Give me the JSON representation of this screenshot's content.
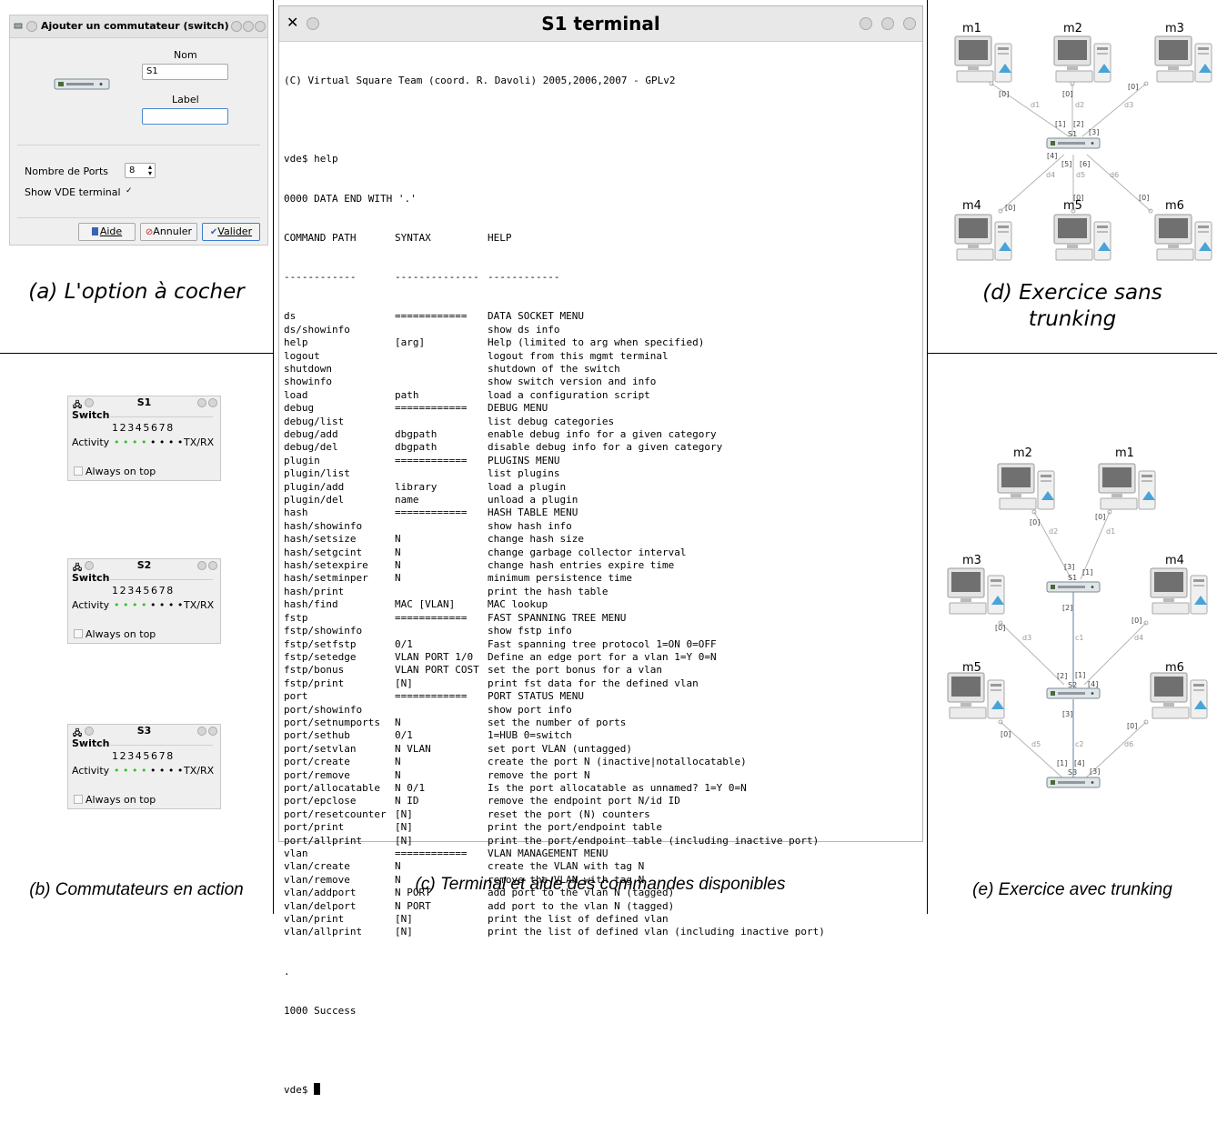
{
  "captions": {
    "a": "(a) L'option à cocher",
    "b": "(b) Commutateurs en action",
    "c": "(c) Terminal et aide des commandes disponibles",
    "d": "(d) Exercice sans trunking",
    "e": "(e) Exercice avec trunking"
  },
  "dialog": {
    "title": "Ajouter un commutateur (switch)",
    "nom_label": "Nom",
    "nom_value": "S1",
    "label_label": "Label",
    "label_value": "",
    "ports_label": "Nombre de Ports",
    "ports_value": "8",
    "show_terminal_label": "Show VDE terminal",
    "show_terminal_checked": "✓",
    "btn_aide": "Aide",
    "btn_annuler": "Annuler",
    "btn_valider": "Valider"
  },
  "switches": [
    {
      "title": "S1",
      "group": "Switch",
      "ports": "12345678",
      "activity_label": "Activity",
      "dots": "• • • • • • • •",
      "txrx": "TX/RX",
      "always_on_top": "Always on top"
    },
    {
      "title": "S2",
      "group": "Switch",
      "ports": "12345678",
      "activity_label": "Activity",
      "dots": "• • • • • • • •",
      "txrx": "TX/RX",
      "always_on_top": "Always on top"
    },
    {
      "title": "S3",
      "group": "Switch",
      "ports": "12345678",
      "activity_label": "Activity",
      "dots": "• • • • • • • •",
      "txrx": "TX/RX",
      "always_on_top": "Always on top"
    }
  ],
  "terminal": {
    "title": "S1 terminal",
    "header": "(C) Virtual Square Team (coord. R. Davoli) 2005,2006,2007 - GPLv2",
    "prompt_cmd": "vde$ help",
    "data_end": "0000 DATA END WITH '.'",
    "col_headers": [
      "COMMAND PATH",
      "SYNTAX",
      "HELP"
    ],
    "col_rules": [
      "------------",
      "--------------",
      "------------"
    ],
    "rows": [
      [
        "ds",
        "============",
        "DATA SOCKET MENU"
      ],
      [
        "ds/showinfo",
        "",
        "show ds info"
      ],
      [
        "help",
        "[arg]",
        "Help (limited to arg when specified)"
      ],
      [
        "logout",
        "",
        "logout from this mgmt terminal"
      ],
      [
        "shutdown",
        "",
        "shutdown of the switch"
      ],
      [
        "showinfo",
        "",
        "show switch version and info"
      ],
      [
        "load",
        "path",
        "load a configuration script"
      ],
      [
        "debug",
        "============",
        "DEBUG MENU"
      ],
      [
        "debug/list",
        "",
        "list debug categories"
      ],
      [
        "debug/add",
        "dbgpath",
        "enable debug info for a given category"
      ],
      [
        "debug/del",
        "dbgpath",
        "disable debug info for a given category"
      ],
      [
        "plugin",
        "============",
        "PLUGINS MENU"
      ],
      [
        "plugin/list",
        "",
        "list plugins"
      ],
      [
        "plugin/add",
        "library",
        "load a plugin"
      ],
      [
        "plugin/del",
        "name",
        "unload a plugin"
      ],
      [
        "hash",
        "============",
        "HASH TABLE MENU"
      ],
      [
        "hash/showinfo",
        "",
        "show hash info"
      ],
      [
        "hash/setsize",
        "N",
        "change hash size"
      ],
      [
        "hash/setgcint",
        "N",
        "change garbage collector interval"
      ],
      [
        "hash/setexpire",
        "N",
        "change hash entries expire time"
      ],
      [
        "hash/setminper",
        "N",
        "minimum persistence time"
      ],
      [
        "hash/print",
        "",
        "print the hash table"
      ],
      [
        "hash/find",
        "MAC [VLAN]",
        "MAC lookup"
      ],
      [
        "fstp",
        "============",
        "FAST SPANNING TREE MENU"
      ],
      [
        "fstp/showinfo",
        "",
        "show fstp info"
      ],
      [
        "fstp/setfstp",
        "0/1",
        "Fast spanning tree protocol 1=ON 0=OFF"
      ],
      [
        "fstp/setedge",
        "VLAN PORT 1/0",
        "Define an edge port for a vlan 1=Y 0=N"
      ],
      [
        "fstp/bonus",
        "VLAN PORT COST",
        "set the port bonus for a vlan"
      ],
      [
        "fstp/print",
        "[N]",
        "print fst data for the defined vlan"
      ],
      [
        "port",
        "============",
        "PORT STATUS MENU"
      ],
      [
        "port/showinfo",
        "",
        "show port info"
      ],
      [
        "port/setnumports",
        "N",
        "set the number of ports"
      ],
      [
        "port/sethub",
        "0/1",
        "1=HUB 0=switch"
      ],
      [
        "port/setvlan",
        "N VLAN",
        "set port VLAN (untagged)"
      ],
      [
        "port/create",
        "N",
        "create the port N (inactive|notallocatable)"
      ],
      [
        "port/remove",
        "N",
        "remove the port N"
      ],
      [
        "port/allocatable",
        "N 0/1",
        "Is the port allocatable as unnamed? 1=Y 0=N"
      ],
      [
        "port/epclose",
        "N ID",
        "remove the endpoint port N/id ID"
      ],
      [
        "port/resetcounter",
        "[N]",
        "reset the port (N) counters"
      ],
      [
        "port/print",
        "[N]",
        "print the port/endpoint table"
      ],
      [
        "port/allprint",
        "[N]",
        "print the port/endpoint table (including inactive port)"
      ],
      [
        "vlan",
        "============",
        "VLAN MANAGEMENT MENU"
      ],
      [
        "vlan/create",
        "N",
        "create the VLAN with tag N"
      ],
      [
        "vlan/remove",
        "N",
        "remove the VLAN with tag N"
      ],
      [
        "vlan/addport",
        "N PORT",
        "add port to the vlan N (tagged)"
      ],
      [
        "vlan/delport",
        "N PORT",
        "add port to the vlan N (tagged)"
      ],
      [
        "vlan/print",
        "[N]",
        "print the list of defined vlan"
      ],
      [
        "vlan/allprint",
        "[N]",
        "print the list of defined vlan (including inactive port)"
      ]
    ],
    "dot": ".",
    "success": "1000 Success",
    "prompt": "vde$"
  },
  "diagram_d": {
    "machines": [
      "m1",
      "m2",
      "m3",
      "m4",
      "m5",
      "m6"
    ],
    "switch": "S1",
    "links": [
      "d1",
      "d2",
      "d3",
      "d4",
      "d5",
      "d6"
    ],
    "ports": [
      "[0]",
      "[1]",
      "[2]",
      "[3]",
      "[4]",
      "[5]",
      "[6]"
    ]
  },
  "diagram_e": {
    "machines": [
      "m2",
      "m1",
      "m3",
      "m4",
      "m5",
      "m6"
    ],
    "switches": [
      "S1",
      "S2",
      "S3"
    ],
    "links": [
      "d1",
      "d2",
      "d3",
      "d4",
      "d5",
      "d6",
      "c1",
      "c2"
    ],
    "ports": [
      "[0]",
      "[1]",
      "[2]",
      "[3]",
      "[4]"
    ]
  }
}
